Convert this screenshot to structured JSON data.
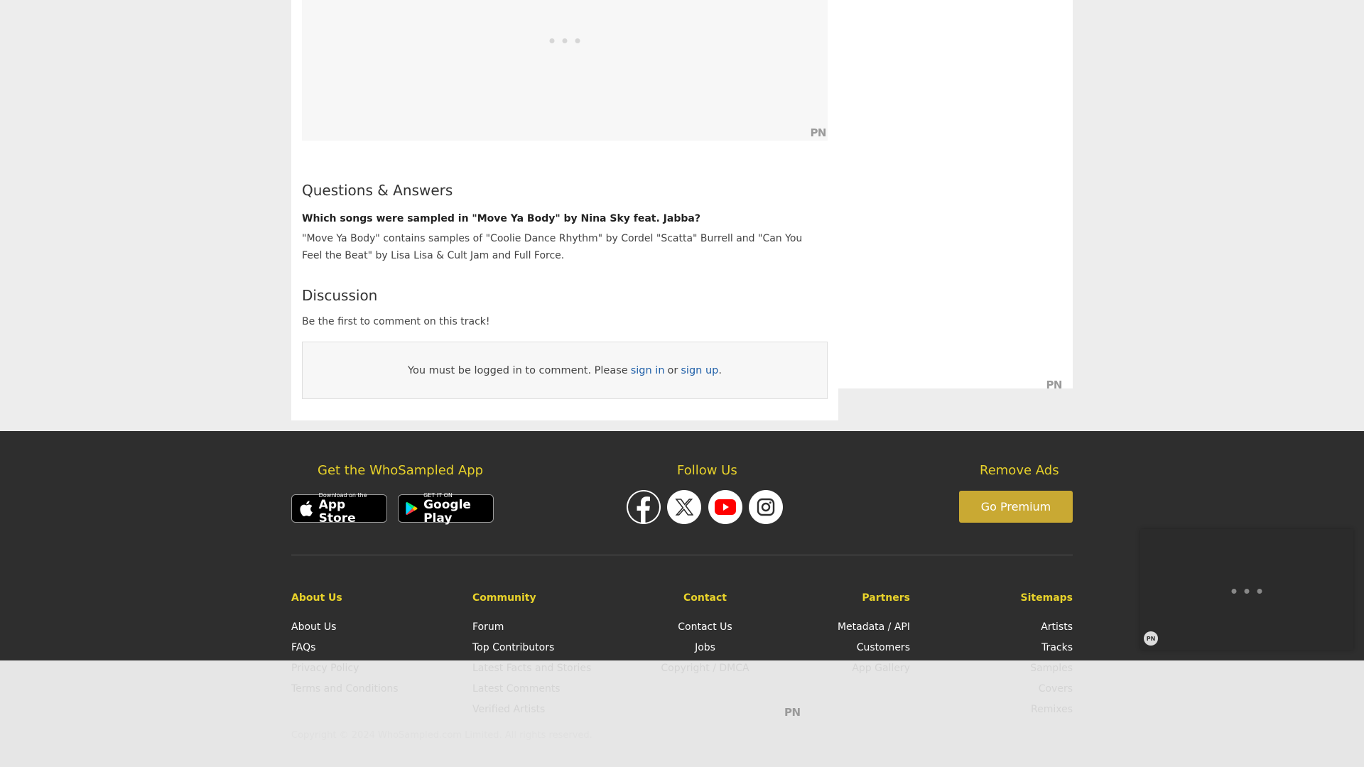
{
  "ad_marks": {
    "pn_main": "PN",
    "pn_side": "PN",
    "pn_footer": "PN",
    "pn_float": "PN"
  },
  "qa": {
    "title": "Questions & Answers",
    "question": "Which songs were sampled in \"Move Ya Body\" by Nina Sky feat. Jabba?",
    "answer": "\"Move Ya Body\" contains samples of \"Coolie Dance Rhythm\" by Cordel \"Scatta\" Burrell and \"Can You Feel the Beat\" by Lisa Lisa & Cult Jam and Full Force."
  },
  "discussion": {
    "title": "Discussion",
    "empty_text": "Be the first to comment on this track!",
    "login_prefix": "You must be logged in to comment. Please",
    "sign_in": "sign in",
    "or": "or",
    "sign_up": "sign up",
    "period": "."
  },
  "footer": {
    "app_heading": "Get the WhoSampled App",
    "appstore_small": "Download on the",
    "appstore_big": "App Store",
    "gplay_small": "GET IT ON",
    "gplay_big": "Google Play",
    "follow_heading": "Follow Us",
    "social": [
      "facebook-icon",
      "x-icon",
      "youtube-icon",
      "instagram-icon"
    ],
    "remove_ads_heading": "Remove Ads",
    "premium_label": "Go Premium",
    "columns": [
      {
        "heading": "About Us",
        "links": [
          "About Us",
          "FAQs",
          "Privacy Policy",
          "Terms and Conditions"
        ]
      },
      {
        "heading": "Community",
        "links": [
          "Forum",
          "Top Contributors",
          "Latest Facts and Stories",
          "Latest Comments",
          "Verified Artists"
        ]
      },
      {
        "heading": "Contact",
        "links": [
          "Contact Us",
          "Jobs",
          "Copyright / DMCA"
        ]
      },
      {
        "heading": "Partners",
        "links": [
          "Metadata / API",
          "Customers",
          "App Gallery"
        ]
      },
      {
        "heading": "Sitemaps",
        "links": [
          "Artists",
          "Tracks",
          "Samples",
          "Covers",
          "Remixes"
        ]
      }
    ],
    "copyright": "Copyright © 2024 WhoSampled.com Limited. All rights reserved."
  },
  "colors": {
    "accent": "#e8d22a",
    "premium": "#c9a933",
    "link": "#1f5fa8",
    "footer_bg": "#2e2e2e"
  }
}
